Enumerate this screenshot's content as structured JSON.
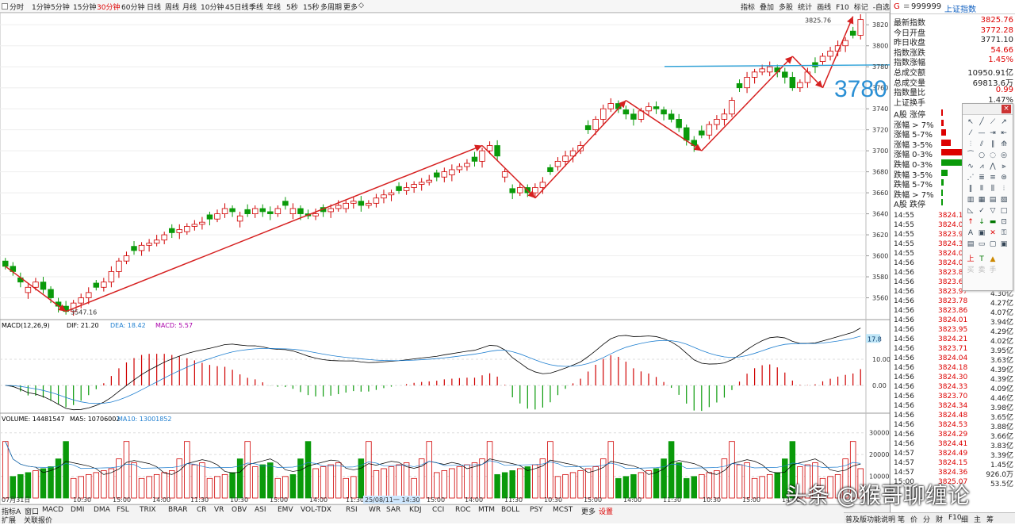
{
  "colors": {
    "up": "#d00000",
    "down": "#0a9a0a",
    "ma5": "#000000",
    "ma10": "#1f7fd0",
    "arrow": "#d62020",
    "hline": "#29a0d8"
  },
  "toolbar": {
    "left": [
      "分时",
      "1分钟",
      "5分钟",
      "15分钟",
      "30分钟",
      "60分钟",
      "日线",
      "周线",
      "月线",
      "10分钟",
      "45日线",
      "季线",
      "年线",
      "5秒",
      "15秒",
      "多周期",
      "更多"
    ],
    "active": "30分钟",
    "right": [
      "指标",
      "叠加",
      "多股",
      "统计",
      "画线",
      "F10",
      "标记",
      "-自选"
    ]
  },
  "info": {
    "code": "999999",
    "name": "上证指数",
    "prefix": "G",
    "stats": [
      {
        "label": "最新指数",
        "value": "3825.76",
        "cls": "red"
      },
      {
        "label": "今日开盘",
        "value": "3772.28",
        "cls": "red"
      },
      {
        "label": "昨日收盘",
        "value": "3771.10",
        "cls": ""
      },
      {
        "label": "指数涨跌",
        "value": "54.66",
        "cls": "red"
      },
      {
        "label": "指数涨幅",
        "value": "1.45%",
        "cls": "red"
      },
      {
        "label": "总成交额",
        "value": "10950.91亿",
        "cls": ""
      },
      {
        "label": "总成交量",
        "value": "69813.6万",
        "cls": ""
      },
      {
        "label": "指数量比",
        "value": "0.99",
        "cls": "red"
      },
      {
        "label": "上证换手",
        "value": "1.47%",
        "cls": ""
      }
    ],
    "breadth": [
      "A股 涨停",
      "涨幅 > 7%",
      "涨幅 5-7%",
      "涨幅 3-5%",
      "涨幅 0-3%",
      "跌幅 0-3%",
      "跌幅 3-5%",
      "跌幅 5-7%",
      "跌幅 > 7%",
      "A股 跌停"
    ],
    "ticks": [
      [
        "14:55",
        "3824.18"
      ],
      [
        "14:55",
        "3824.06"
      ],
      [
        "14:55",
        "3823.93"
      ],
      [
        "14:55",
        "3824.31"
      ],
      [
        "14:55",
        "3824.04"
      ],
      [
        "14:56",
        "3824.05"
      ],
      [
        "14:56",
        "3823.88"
      ],
      [
        "14:56",
        "3823.60"
      ],
      [
        "14:56",
        "3823.97",
        "4.30亿"
      ],
      [
        "14:56",
        "3823.78",
        "4.27亿"
      ],
      [
        "14:56",
        "3823.86",
        "4.07亿"
      ],
      [
        "14:56",
        "3824.01",
        "3.94亿"
      ],
      [
        "14:56",
        "3823.95",
        "4.29亿"
      ],
      [
        "14:56",
        "3824.21",
        "4.02亿"
      ],
      [
        "14:56",
        "3823.71",
        "3.95亿"
      ],
      [
        "14:56",
        "3824.04",
        "3.63亿"
      ],
      [
        "14:56",
        "3824.18",
        "4.39亿"
      ],
      [
        "14:56",
        "3824.30",
        "4.39亿"
      ],
      [
        "14:56",
        "3824.33",
        "4.09亿"
      ],
      [
        "14:56",
        "3823.70",
        "4.46亿"
      ],
      [
        "14:56",
        "3824.34",
        "3.98亿"
      ],
      [
        "14:56",
        "3824.48",
        "3.65亿"
      ],
      [
        "14:56",
        "3824.53",
        "3.88亿"
      ],
      [
        "14:56",
        "3824.29",
        "3.66亿"
      ],
      [
        "14:56",
        "3824.41",
        "3.83亿"
      ],
      [
        "14:57",
        "3824.49",
        "3.39亿"
      ],
      [
        "14:57",
        "3824.15",
        "1.45亿"
      ],
      [
        "14:57",
        "3824.36",
        "926.0万"
      ],
      [
        "15:00",
        "3825.07",
        "53.5亿"
      ]
    ]
  },
  "main": {
    "yticks": [
      "3820",
      "3800",
      "3780",
      "3760",
      "3740",
      "3720",
      "3700",
      "3680",
      "3660",
      "3640",
      "3620",
      "3600",
      "3580",
      "3560"
    ],
    "label_low": "3547.16",
    "label_high": "3825.76",
    "big_label": "3780"
  },
  "macd": {
    "title": "MACD(12,26,9)",
    "dif": "DIF: 21.20",
    "dea": "DEA: 18.42",
    "macd": "MACD: 5.57",
    "yticks": [
      "10.00",
      "0.00"
    ],
    "flag": "17.8"
  },
  "volume": {
    "title": "VOLUME: 14481547",
    "ma5": "MA5: 10706002",
    "ma10": "MA10: 13001852",
    "yticks": [
      "30000",
      "20000",
      "10000"
    ]
  },
  "xaxis": [
    "07月31日",
    "10:30",
    "15:00",
    "14:00",
    "11:30",
    "10:30",
    "15:00",
    "14:00",
    "11:30",
    "25/08/11一 14:30",
    "15:00",
    "14:00",
    "11:30",
    "10:30",
    "15:00",
    "14:00",
    "11:30",
    "10:30",
    "15:00",
    "14:00"
  ],
  "bottom": {
    "row1": [
      "指标A",
      "窗口",
      "MACD",
      "DMI",
      "DMA",
      "FSL",
      "TRIX",
      "BRAR",
      "CR",
      "VR",
      "OBV",
      "ASI",
      "EMV",
      "VOL-TDX",
      "RSI",
      "WR",
      "SAR",
      "KDJ",
      "CCI",
      "ROC",
      "MTM",
      "BOLL",
      "PSY",
      "MCST",
      "更多",
      "设置"
    ],
    "row2": [
      "扩展",
      "关联报价"
    ],
    "right": [
      "普及版功能说明",
      "笔",
      "价",
      "分",
      "财",
      "F10",
      "细",
      "主",
      "筹"
    ]
  },
  "watermark": "头条 @猴哥聊缠论",
  "chart_data": [
    {
      "type": "candlestick",
      "title": "上证指数 30分钟",
      "ylim": [
        3540,
        3830
      ],
      "close": [
        3590,
        3585,
        3575,
        3570,
        3575,
        3568,
        3560,
        3552,
        3547,
        3555,
        3560,
        3565,
        3570,
        3575,
        3585,
        3595,
        3600,
        3605,
        3610,
        3612,
        3615,
        3620,
        3622,
        3625,
        3628,
        3630,
        3632,
        3635,
        3640,
        3645,
        3642,
        3638,
        3640,
        3645,
        3642,
        3640,
        3645,
        3648,
        3645,
        3640,
        3638,
        3640,
        3642,
        3645,
        3648,
        3650,
        3652,
        3648,
        3650,
        3655,
        3658,
        3660,
        3662,
        3665,
        3668,
        3670,
        3672,
        3675,
        3680,
        3682,
        3685,
        3688,
        3690,
        3700,
        3705,
        3695,
        3680,
        3660,
        3665,
        3660,
        3665,
        3670,
        3680,
        3690,
        3695,
        3700,
        3705,
        3720,
        3730,
        3740,
        3745,
        3740,
        3735,
        3730,
        3738,
        3742,
        3740,
        3735,
        3730,
        3722,
        3710,
        3705,
        3715,
        3725,
        3730,
        3735,
        3748,
        3760,
        3770,
        3775,
        3778,
        3780,
        3775,
        3770,
        3760,
        3765,
        3775,
        3780,
        3790,
        3795,
        3800,
        3805,
        3810,
        3825
      ],
      "volume_range": [
        0,
        35000
      ]
    },
    {
      "type": "line",
      "title": "MACD(12,26,9)",
      "series": [
        {
          "name": "DIF"
        },
        {
          "name": "DEA"
        }
      ],
      "values_shown": {
        "DIF": 21.2,
        "DEA": 18.42,
        "MACD": 5.57
      }
    },
    {
      "type": "bar",
      "title": "VOLUME",
      "values_shown": {
        "VOLUME": 14481547,
        "MA5": 10706002,
        "MA10": 13001852
      }
    }
  ]
}
